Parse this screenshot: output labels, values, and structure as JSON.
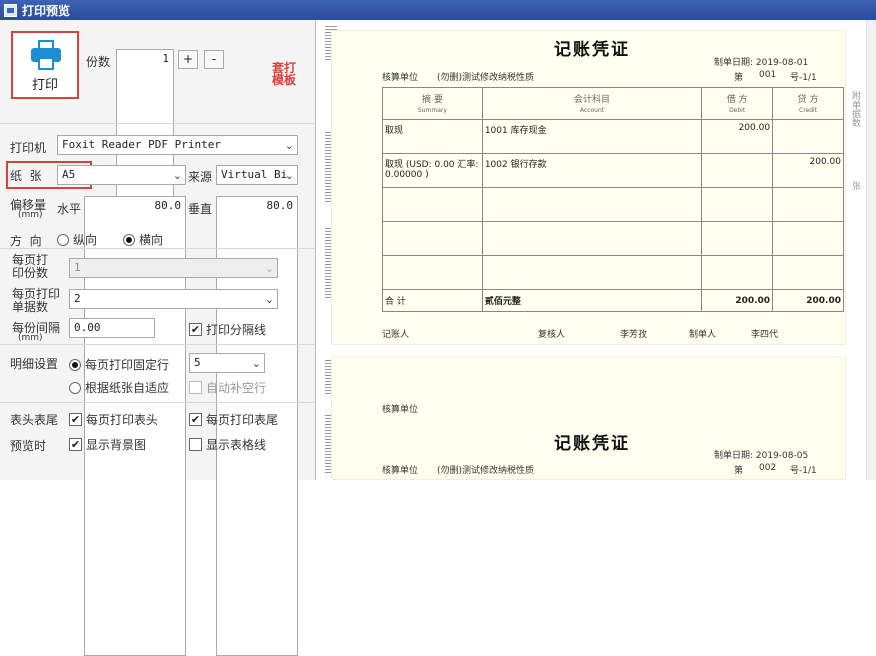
{
  "window": {
    "title": "打印预览"
  },
  "left": {
    "print_button": "打印",
    "copies": {
      "label": "份数",
      "value": "1",
      "plus": "+",
      "minus": "-"
    },
    "template_link": "套打\n模板",
    "printer": {
      "label": "打印机",
      "value": "Foxit Reader PDF Printer"
    },
    "paper": {
      "label": "纸  张",
      "value": "A5",
      "source_label": "来源",
      "source_value": "Virtual Bi"
    },
    "offset": {
      "label": "偏移量",
      "unit": "(mm)",
      "h_label": "水平",
      "h_value": "80.0",
      "v_label": "垂直",
      "v_value": "80.0"
    },
    "orientation": {
      "label": "方  向",
      "portrait": "纵向",
      "landscape": "横向",
      "selected": "landscape"
    },
    "per_page_copies": {
      "label": "每页打\n印份数",
      "value": "1"
    },
    "per_page_docs": {
      "label": "每页打印\n单据数",
      "value": "2"
    },
    "spacing": {
      "label": "每份间隔",
      "unit": "(mm)",
      "value": "0.00",
      "separator_label": "打印分隔线",
      "separator_checked": true
    },
    "detail": {
      "label": "明细设置",
      "fixed_rows_label": "每页打印固定行",
      "fixed_rows_value": "5",
      "adapt_label": "根据纸张自适应",
      "autofill_label": "自动补空行"
    },
    "header_footer": {
      "label": "表头表尾",
      "print_header": "每页打印表头",
      "print_footer": "每页打印表尾"
    },
    "preview": {
      "label": "预览时",
      "show_bg": "显示背景图",
      "show_grid": "显示表格线"
    }
  },
  "vouchers": [
    {
      "title": "记账凭证",
      "unit_label": "核算单位",
      "unit_value": "(勿删)测试修改纳税性质",
      "date": "制单日期:  2019-08-01",
      "number_prefix": "第",
      "number": "001",
      "number_suffix": "号-1/1",
      "headers": {
        "summary": "摘  要",
        "summary_en": "Summary",
        "account": "会计科目",
        "account_en": "Account",
        "debit": "借  方",
        "debit_en": "Debit",
        "credit": "贷  方",
        "credit_en": "Credit"
      },
      "rows": [
        {
          "summary": "取现",
          "account": "1001 库存现金",
          "debit": "200.00",
          "credit": ""
        },
        {
          "summary": "取现 (USD: 0.00 汇率: 0.00000 )",
          "account": "1002 银行存款",
          "debit": "",
          "credit": "200.00"
        },
        {
          "summary": "",
          "account": "",
          "debit": "",
          "credit": ""
        },
        {
          "summary": "",
          "account": "",
          "debit": "",
          "credit": ""
        },
        {
          "summary": "",
          "account": "",
          "debit": "",
          "credit": ""
        }
      ],
      "total_label": "合  计",
      "total_words": "贰佰元整",
      "total_debit": "200.00",
      "total_credit": "200.00",
      "bookkeeper_label": "记账人",
      "checker_label": "复核人",
      "checker": "李芳孜",
      "maker_label": "制单人",
      "maker": "李四代",
      "side_label": "附单据数",
      "side_label2": "张"
    },
    {
      "title": "记账凭证",
      "unit_label": "核算单位",
      "unit_value": "(勿删)测试修改纳税性质",
      "date": "制单日期:  2019-08-05",
      "number_prefix": "第",
      "number": "002",
      "number_suffix": "号-1/1"
    }
  ]
}
